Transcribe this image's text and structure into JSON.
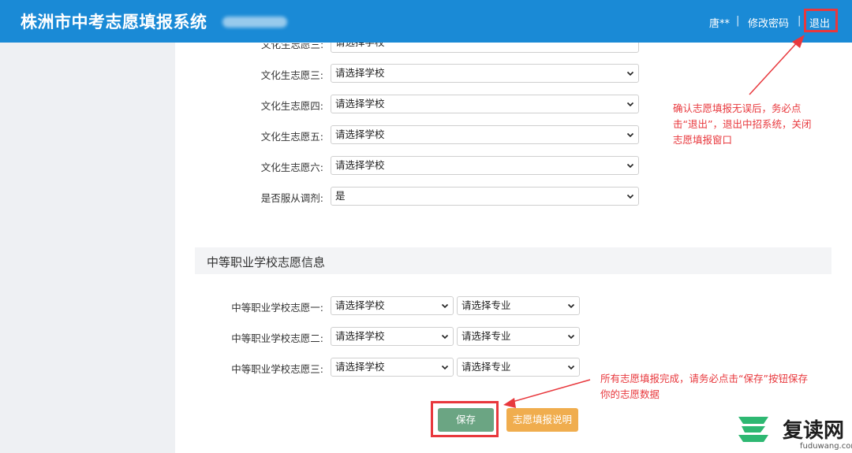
{
  "header": {
    "title": "株洲市中考志愿填报系统",
    "user": "唐**",
    "sep1": "|",
    "change_password": "修改密码",
    "sep2": "|",
    "logout": "退出"
  },
  "culture": {
    "partial_label": "文化生志愿三:",
    "partial_value": "请选择学校",
    "rows": [
      {
        "label": "文化生志愿三:",
        "value": "请选择学校"
      },
      {
        "label": "文化生志愿四:",
        "value": "请选择学校"
      },
      {
        "label": "文化生志愿五:",
        "value": "请选择学校"
      },
      {
        "label": "文化生志愿六:",
        "value": "请选择学校"
      },
      {
        "label": "是否服从调剂:",
        "value": "是"
      }
    ]
  },
  "vocational": {
    "section_title": "中等职业学校志愿信息",
    "rows": [
      {
        "label": "中等职业学校志愿一:",
        "school": "请选择学校",
        "major": "请选择专业"
      },
      {
        "label": "中等职业学校志愿二:",
        "school": "请选择学校",
        "major": "请选择专业"
      },
      {
        "label": "中等职业学校志愿三:",
        "school": "请选择学校",
        "major": "请选择专业"
      }
    ]
  },
  "buttons": {
    "save": "保存",
    "guide": "志愿填报说明"
  },
  "annotations": {
    "logout_note": [
      "确认志愿填报无误后，务必点",
      "击“退出”，退出中招系统，关闭",
      "志愿填报窗口"
    ],
    "save_note": [
      "所有志愿填报完成，请务必点击“保存”按钮保存",
      "你的志愿数据"
    ]
  },
  "watermark": {
    "brand": "复读网",
    "url": "fuduwang.com"
  },
  "colors": {
    "header_bg": "#1a8ad6",
    "save_btn": "#6ba583",
    "guide_btn": "#f0ad4e",
    "annotation_red": "#e8383d",
    "logo_green": "#2eb872"
  }
}
